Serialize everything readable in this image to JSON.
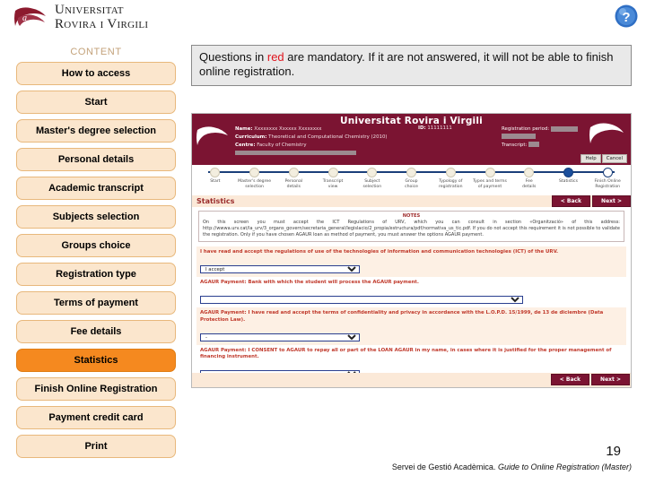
{
  "header": {
    "university_line1": "Universitat",
    "university_line2": "Rovira i Virgili",
    "help_icon": "question-mark-help-icon"
  },
  "sidebar": {
    "title": "CONTENT",
    "items": [
      {
        "label": "How to access",
        "active": false
      },
      {
        "label": "Start",
        "active": false
      },
      {
        "label": "Master's degree selection",
        "active": false
      },
      {
        "label": "Personal details",
        "active": false
      },
      {
        "label": "Academic transcript",
        "active": false
      },
      {
        "label": "Subjects selection",
        "active": false
      },
      {
        "label": "Groups choice",
        "active": false
      },
      {
        "label": "Registration type",
        "active": false
      },
      {
        "label": "Terms of payment",
        "active": false
      },
      {
        "label": "Fee details",
        "active": false
      },
      {
        "label": "Statistics",
        "active": true
      },
      {
        "label": "Finish Online Registration",
        "active": false
      },
      {
        "label": "Payment credit card",
        "active": false
      },
      {
        "label": "Print",
        "active": false
      }
    ]
  },
  "callout": {
    "part1": "Questions in ",
    "red": "red",
    "part2": " are mandatory. If it are not answered, it will not be able to finish online registration."
  },
  "screenshot": {
    "app_title": "Universitat Rovira i Virgili",
    "name_label": "Name:",
    "name_value": "Xxxxxxxx Xxxxxx Xxxxxxxx",
    "curriculum_label": "Curriculum:",
    "curriculum_value": "Theoretical and Computational Chemistry (2010)",
    "centre_label": "Centre:",
    "centre_value": "Faculty of Chemistry",
    "id_label": "ID:",
    "id_value": "11111111",
    "registration_period_label": "Registration period:",
    "transcript_label": "Transcript:",
    "help_button": "Help",
    "cancel_button": "Cancel",
    "steps": [
      {
        "label": "Start",
        "state": "done"
      },
      {
        "label": "Master's degree\nselection",
        "state": "done"
      },
      {
        "label": "Personal\ndetails",
        "state": "done"
      },
      {
        "label": "Transcript\nview",
        "state": "done"
      },
      {
        "label": "Subject\nselection",
        "state": "done"
      },
      {
        "label": "Group\nchoice",
        "state": "done"
      },
      {
        "label": "Typology of\nregistration",
        "state": "done"
      },
      {
        "label": "Types and terms\nof payment",
        "state": "done"
      },
      {
        "label": "Fee\ndetails",
        "state": "done"
      },
      {
        "label": "Statistics",
        "state": "current"
      },
      {
        "label": "Finish Online\nRegistration",
        "state": "last"
      }
    ],
    "section_title": "Statistics",
    "back_button": "< Back",
    "next_button": "Next >",
    "notes_title": "NOTES",
    "notes_text": "On this screen you must accept the ICT Regulations of URV, which you can consult in section «Organització» of this address: http://wwwa.urv.cat/la_urv/3_organs_govern/secretaria_general/legislacio/2_propia/estructura/pdf/normativa_us_tic.pdf. If you do not accept this requirement it is not possible to validate the registration. Only if you have chosen AGAUR loan as method of payment, you must answer the options AGAUR payment.",
    "fields": [
      {
        "label": "I have read and accept the regulations of use of the technologies of information and communication technologies (ICT) of the URV.",
        "value": "I accept",
        "width": "narrow",
        "shaded": true
      },
      {
        "label": "AGAUR Payment: Bank with which the student will process the AGAUR payment.",
        "value": "",
        "width": "wide",
        "shaded": false
      },
      {
        "label": "AGAUR Payment: I have read and accept the terms of confidentiality and privacy in accordance with the L.O.P.D. 15/1999, de 13 de diciembre (Data Protection Law).",
        "value": "-",
        "width": "narrow",
        "shaded": true
      },
      {
        "label": "AGAUR Payment: I CONSENT to AGAUR to repay all or part of the LOAN AGAUR in my name, in cases where it is justified for the proper management of financing instrument.",
        "value": "",
        "width": "narrow",
        "shaded": false
      }
    ]
  },
  "footer": {
    "page_number": "19",
    "credit_plain": "Servei de Gestió Acadèmica. ",
    "credit_italic": "Guide to Online Registration (Master)"
  },
  "colors": {
    "accent_orange": "#f5891f",
    "nav_fill": "#fbe6cd",
    "nav_border": "#e8b87c",
    "app_maroon": "#7b1432",
    "step_blue": "#1b4f9c",
    "red_text": "#e0141e"
  }
}
